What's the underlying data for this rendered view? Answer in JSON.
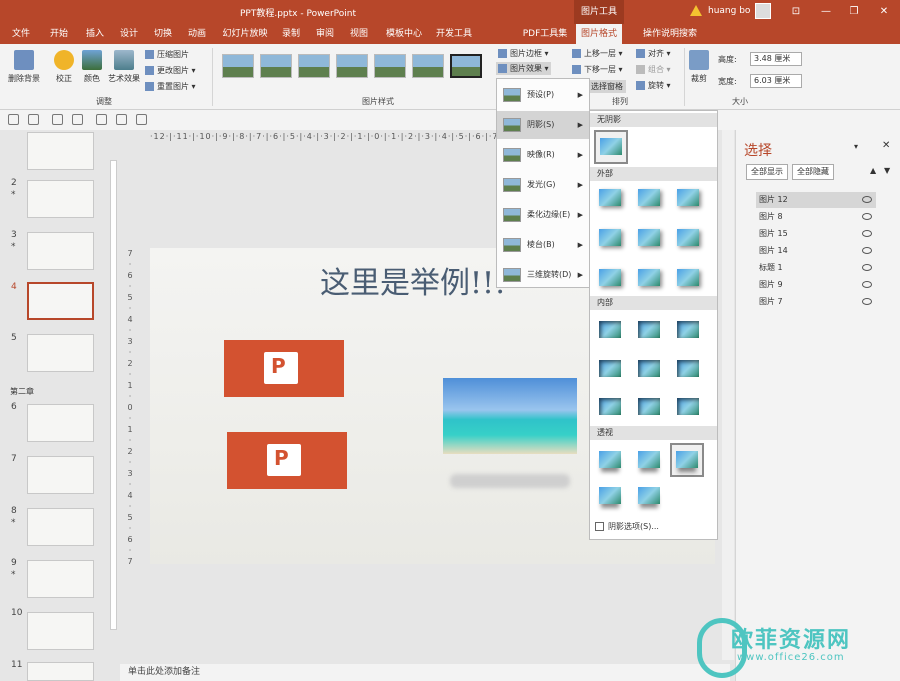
{
  "titlebar": {
    "doc_title": "PPT教程.pptx - PowerPoint",
    "context_tab": "图片工具",
    "user": "huang bo",
    "min": "—",
    "restore": "❐",
    "close": "✕",
    "ribbon_opts": "⊡"
  },
  "tabs": [
    "文件",
    "开始",
    "插入",
    "设计",
    "切换",
    "动画",
    "幻灯片放映",
    "录制",
    "审阅",
    "视图",
    "模板中心",
    "开发工具",
    "PDF工具集",
    "图片格式",
    "操作说明搜索"
  ],
  "ribbon": {
    "remove_bg": "删除背景",
    "correct": "校正",
    "color": "颜色",
    "art_effects": "艺术效果",
    "compress": "压缩图片",
    "change_pic": "更改图片",
    "reset_pic": "重置图片",
    "adjust_group": "调整",
    "styles_group": "图片样式",
    "border": "图片边框",
    "effects": "图片效果",
    "bring_forward": "上移一层",
    "send_backward": "下移一层",
    "selection_pane": "选择窗格",
    "align": "对齐",
    "group": "组合",
    "rotate": "旋转",
    "arrange_group": "排列",
    "crop": "裁剪",
    "height_label": "高度:",
    "height_value": "3.48 厘米",
    "width_label": "宽度:",
    "width_value": "6.03 厘米",
    "size_group": "大小"
  },
  "ruler": {
    "h": "·12·|·11·|·10·|·9·|·8·|·7·|·6·|·5·|·4·|·3·|·2·|·1·|·0·|·1·|·2·|·3·|·4·|·5·|·6·|·7·|·8·|·9·",
    "v": "7 · 6 · 5 · 4 · 3 · 2 · 1 · 0 · 1 · 2 · 3 · 4 · 5 · 6 · 7"
  },
  "thumbs": {
    "chapter2": "第二章",
    "nums": [
      "2",
      "3",
      "4",
      "5",
      "6",
      "7",
      "8",
      "9",
      "10",
      "11"
    ],
    "star": "*"
  },
  "slide": {
    "title": "这里是举例!!!",
    "ppt_letter": "P"
  },
  "notes": "单击此处添加备注",
  "effects_menu": [
    "预设(P)",
    "阴影(S)",
    "映像(R)",
    "发光(G)",
    "柔化边缘(E)",
    "棱台(B)",
    "三维旋转(D)"
  ],
  "shadow_gallery": {
    "none": "无阴影",
    "outer": "外部",
    "inner": "内部",
    "perspective": "透视",
    "options": "阴影选项(S)..."
  },
  "selection_pane": {
    "title": "选择",
    "show_all": "全部显示",
    "hide_all": "全部隐藏",
    "items": [
      "图片 12",
      "图片 8",
      "图片 15",
      "图片 14",
      "标题 1",
      "图片 9",
      "图片 7"
    ]
  },
  "watermark": {
    "name": "欧菲资源网",
    "url": "www.office26.com"
  }
}
